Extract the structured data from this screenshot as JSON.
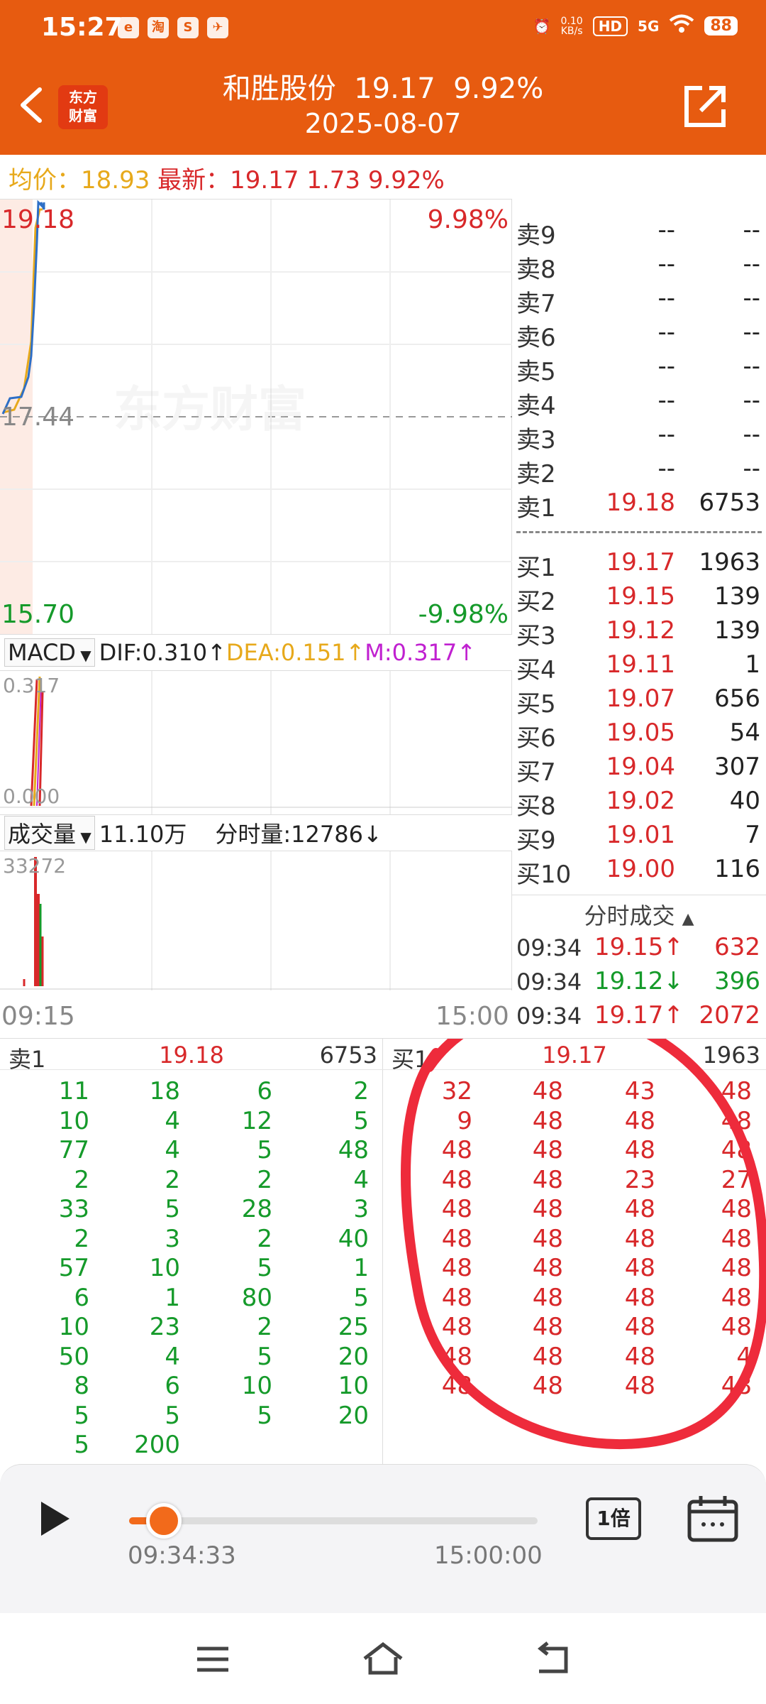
{
  "status": {
    "time": "15:27",
    "apps": [
      "e",
      "淘",
      "S",
      "✈"
    ],
    "net_speed": "0.10\nKB/s",
    "hd": "HD",
    "signal": "5G",
    "battery": "88"
  },
  "header": {
    "logo": "东方\n财富",
    "title": "和胜股份  19.17  9.92%",
    "date": "2025-08-07"
  },
  "info": {
    "avg_label": "均价：",
    "avg_value": "18.93",
    "latest_label": "最新：",
    "latest_value": "19.17",
    "change": "1.73",
    "change_pct": "9.92%"
  },
  "price_chart": {
    "high": "19.18",
    "high_pct": "9.98%",
    "prev_close": "17.44",
    "low": "15.70",
    "low_pct": "-9.98%",
    "watermark": "东方财富"
  },
  "macd": {
    "selector": "MACD",
    "dif": "DIF:0.310↑",
    "dea": "DEA:0.151↑",
    "m": "M:0.317↑",
    "max": "0.317",
    "zero": "0.000"
  },
  "volume": {
    "selector": "成交量",
    "total": "11.10万",
    "tick_vol": "分时量:12786↓",
    "max": "33272",
    "time_start": "09:15",
    "time_end": "15:00"
  },
  "order_book": {
    "asks": [
      {
        "name": "卖9",
        "price": "--",
        "vol": "--"
      },
      {
        "name": "卖8",
        "price": "--",
        "vol": "--"
      },
      {
        "name": "卖7",
        "price": "--",
        "vol": "--"
      },
      {
        "name": "卖6",
        "price": "--",
        "vol": "--"
      },
      {
        "name": "卖5",
        "price": "--",
        "vol": "--"
      },
      {
        "name": "卖4",
        "price": "--",
        "vol": "--"
      },
      {
        "name": "卖3",
        "price": "--",
        "vol": "--"
      },
      {
        "name": "卖2",
        "price": "--",
        "vol": "--"
      },
      {
        "name": "卖1",
        "price": "19.18",
        "vol": "6753"
      }
    ],
    "bids": [
      {
        "name": "买1",
        "price": "19.17",
        "vol": "1963"
      },
      {
        "name": "买2",
        "price": "19.15",
        "vol": "139"
      },
      {
        "name": "买3",
        "price": "19.12",
        "vol": "139"
      },
      {
        "name": "买4",
        "price": "19.11",
        "vol": "1"
      },
      {
        "name": "买5",
        "price": "19.07",
        "vol": "656"
      },
      {
        "name": "买6",
        "price": "19.05",
        "vol": "54"
      },
      {
        "name": "买7",
        "price": "19.04",
        "vol": "307"
      },
      {
        "name": "买8",
        "price": "19.02",
        "vol": "40"
      },
      {
        "name": "买9",
        "price": "19.01",
        "vol": "7"
      },
      {
        "name": "买10",
        "price": "19.00",
        "vol": "116"
      }
    ],
    "ticks_title": "分时成交",
    "ticks": [
      {
        "time": "09:34",
        "price": "19.15↑",
        "vol": "632",
        "dir": "up"
      },
      {
        "time": "09:34",
        "price": "19.12↓",
        "vol": "396",
        "dir": "down"
      },
      {
        "time": "09:34",
        "price": "19.17↑",
        "vol": "2072",
        "dir": "up"
      }
    ]
  },
  "queues": {
    "sell": {
      "name": "卖1",
      "price": "19.18",
      "vol": "6753",
      "rows": [
        [
          "11",
          "18",
          "6",
          "2"
        ],
        [
          "10",
          "4",
          "12",
          "5"
        ],
        [
          "77",
          "4",
          "5",
          "48"
        ],
        [
          "2",
          "2",
          "2",
          "4"
        ],
        [
          "33",
          "5",
          "28",
          "3"
        ],
        [
          "2",
          "3",
          "2",
          "40"
        ],
        [
          "57",
          "10",
          "5",
          "1"
        ],
        [
          "6",
          "1",
          "80",
          "5"
        ],
        [
          "10",
          "23",
          "2",
          "25"
        ],
        [
          "50",
          "4",
          "5",
          "20"
        ],
        [
          "8",
          "6",
          "10",
          "10"
        ],
        [
          "5",
          "5",
          "5",
          "20"
        ],
        [
          "5",
          "200",
          "",
          ""
        ]
      ]
    },
    "buy": {
      "name": "买1",
      "price": "19.17",
      "vol": "1963",
      "rows": [
        [
          "32",
          "48",
          "43",
          "48"
        ],
        [
          "9",
          "48",
          "48",
          "48"
        ],
        [
          "48",
          "48",
          "48",
          "48"
        ],
        [
          "48",
          "48",
          "23",
          "27"
        ],
        [
          "48",
          "48",
          "48",
          "48"
        ],
        [
          "48",
          "48",
          "48",
          "48"
        ],
        [
          "48",
          "48",
          "48",
          "48"
        ],
        [
          "48",
          "48",
          "48",
          "48"
        ],
        [
          "48",
          "48",
          "48",
          "48"
        ],
        [
          "48",
          "48",
          "48",
          "4"
        ],
        [
          "48",
          "48",
          "48",
          "48"
        ]
      ]
    }
  },
  "player": {
    "current": "09:34:33",
    "end": "15:00:00",
    "progress": 0.05,
    "speed": "1倍"
  },
  "colors": {
    "brand": "#E75B10",
    "up": "#D8282A",
    "down": "#159A2A",
    "annotation": "#EE2B3B"
  }
}
